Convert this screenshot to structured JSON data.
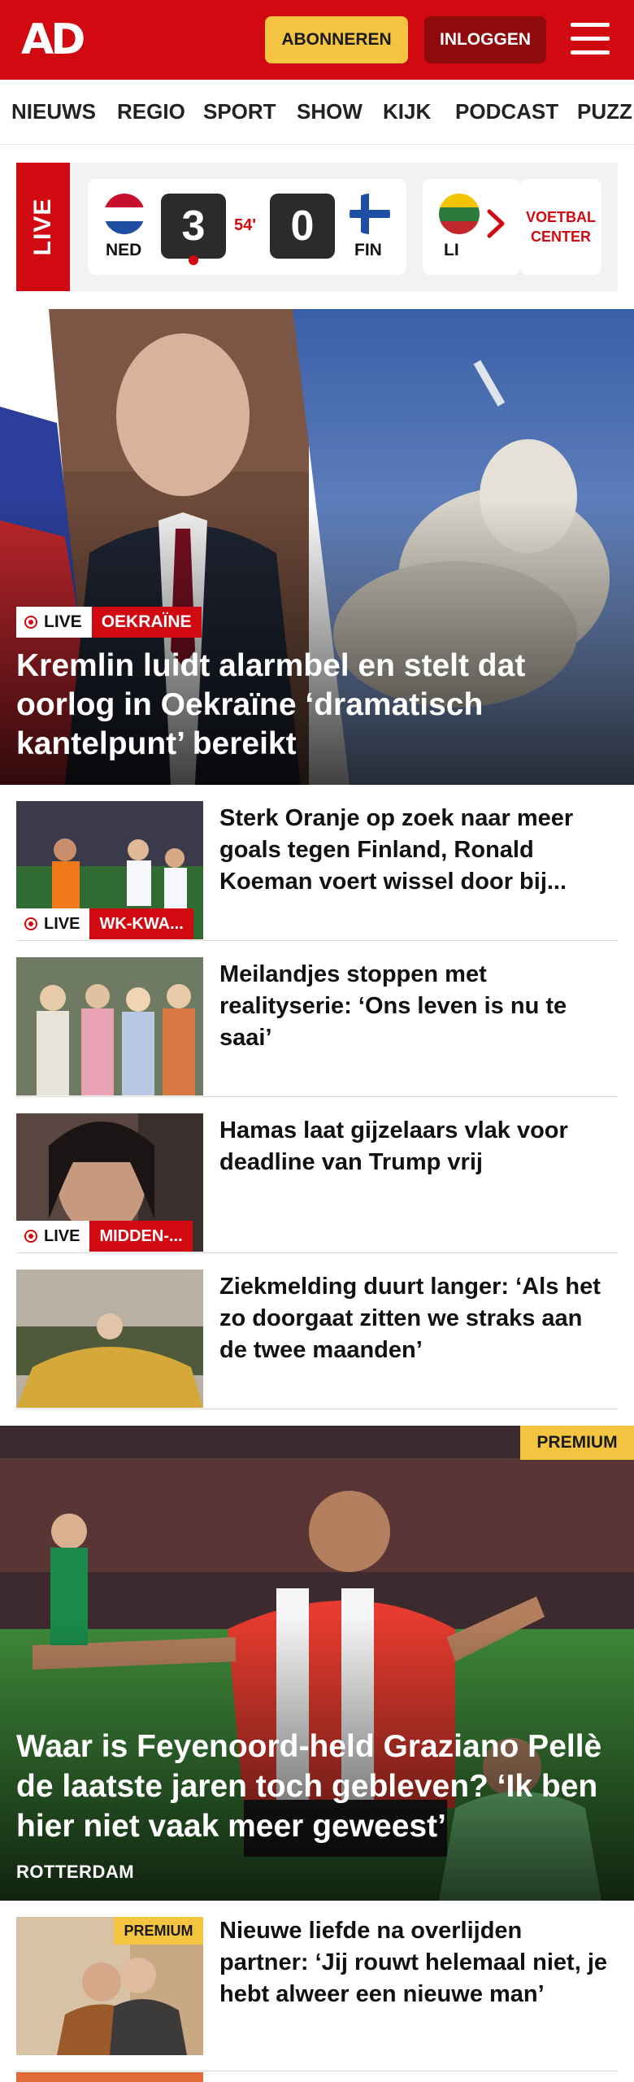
{
  "header": {
    "logo": "AD",
    "subscribe_label": "ABONNEREN",
    "login_label": "INLOGGEN"
  },
  "nav": {
    "items": [
      "NIEUWS",
      "REGIO",
      "SPORT",
      "SHOW",
      "KIJK",
      "PODCAST",
      "PUZZ"
    ]
  },
  "live_strip": {
    "live_label": "LIVE",
    "match": {
      "home_code": "NED",
      "away_code": "FIN",
      "home_score": "3",
      "away_score": "0",
      "minute": "54'"
    },
    "next_match_code": "LI",
    "voetbal_center_line1": "VOETBAL",
    "voetbal_center_line2": "CENTER"
  },
  "hero": {
    "live_label": "LIVE",
    "category": "OEKRAÏNE",
    "title": "Kremlin luidt alarmbel en stelt dat oorlog in Oekraïne ‘dramatisch kantelpunt’ bereikt"
  },
  "articles": [
    {
      "title": "Sterk Oranje op zoek naar meer goals tegen Finland, Ronald Koeman voert wissel door bij...",
      "live_label": "LIVE",
      "category": "WK-KWA..."
    },
    {
      "title": "Meilandjes stoppen met realityserie: ‘Ons leven is nu te saai’"
    },
    {
      "title": "Hamas laat gijzelaars vlak voor deadline van Trump vrij",
      "live_label": "LIVE",
      "category": "MIDDEN-..."
    },
    {
      "title": "Ziekmelding duurt langer: ‘Als het zo doorgaat zitten we straks aan de twee maanden’"
    }
  ],
  "premium_hero": {
    "badge": "PREMIUM",
    "title": "Waar is Feyenoord-held Graziano Pellè de laatste jaren toch gebleven? ‘Ik ben hier niet vaak meer geweest’",
    "location": "ROTTERDAM"
  },
  "bottom_article": {
    "badge": "PREMIUM",
    "title": "Nieuwe liefde na overlijden partner: ‘Jij rouwt helemaal niet, je hebt alweer een nieuwe man’"
  },
  "colors": {
    "brand_red": "#d10a11",
    "premium_yellow": "#f5c542",
    "login_dark_red": "#8f0a0d"
  }
}
